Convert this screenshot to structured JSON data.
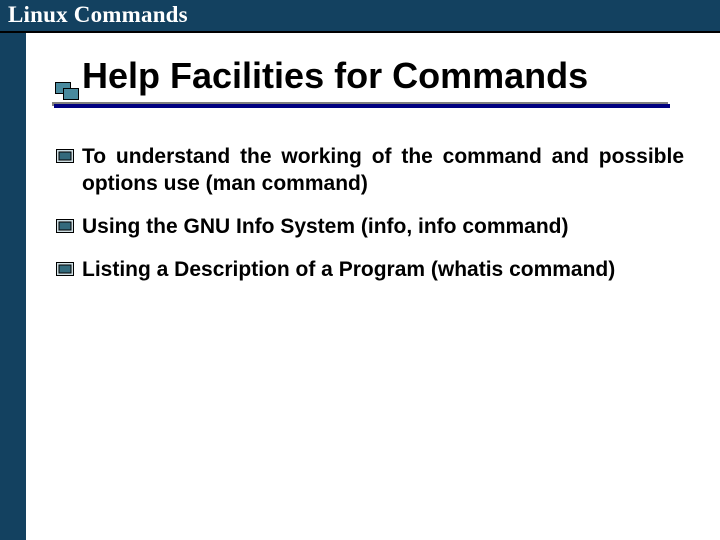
{
  "header": {
    "label": "Linux Commands"
  },
  "title": "Help Facilities for Commands",
  "bullets": [
    {
      "text": "To understand the working of the command and possible options use (man command)",
      "justify": true
    },
    {
      "text": " Using the GNU Info System (info, info command)",
      "justify": false
    },
    {
      "text": "Listing a Description of a Program (whatis command)",
      "justify": false
    }
  ]
}
